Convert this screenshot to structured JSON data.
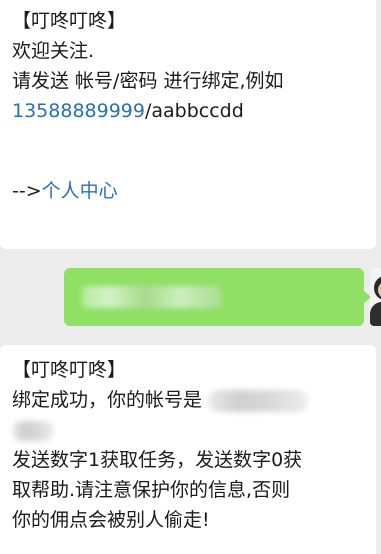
{
  "chat": {
    "msg1": {
      "title": "【叮咚叮咚】",
      "line1": "欢迎关注.",
      "line2": "请发送 帐号/密码 进行绑定,例如",
      "example_phone": "13588889999",
      "example_pwd": "/aabbccdd",
      "link_arrow": "-->",
      "link_text": "个人中心"
    },
    "msg2": {
      "title": "【叮咚叮咚】",
      "line1": "绑定成功，你的帐号是",
      "line3": "发送数字1获取任务，发送数字0获",
      "line4": "取帮助.请注意保护你的信息,否则",
      "line5": "你的佣点会被别人偷走!"
    }
  },
  "colors": {
    "incoming_bg": "#ffffff",
    "outgoing_bg": "#8fe065",
    "link": "#2a6fb8",
    "background": "#ececec"
  }
}
